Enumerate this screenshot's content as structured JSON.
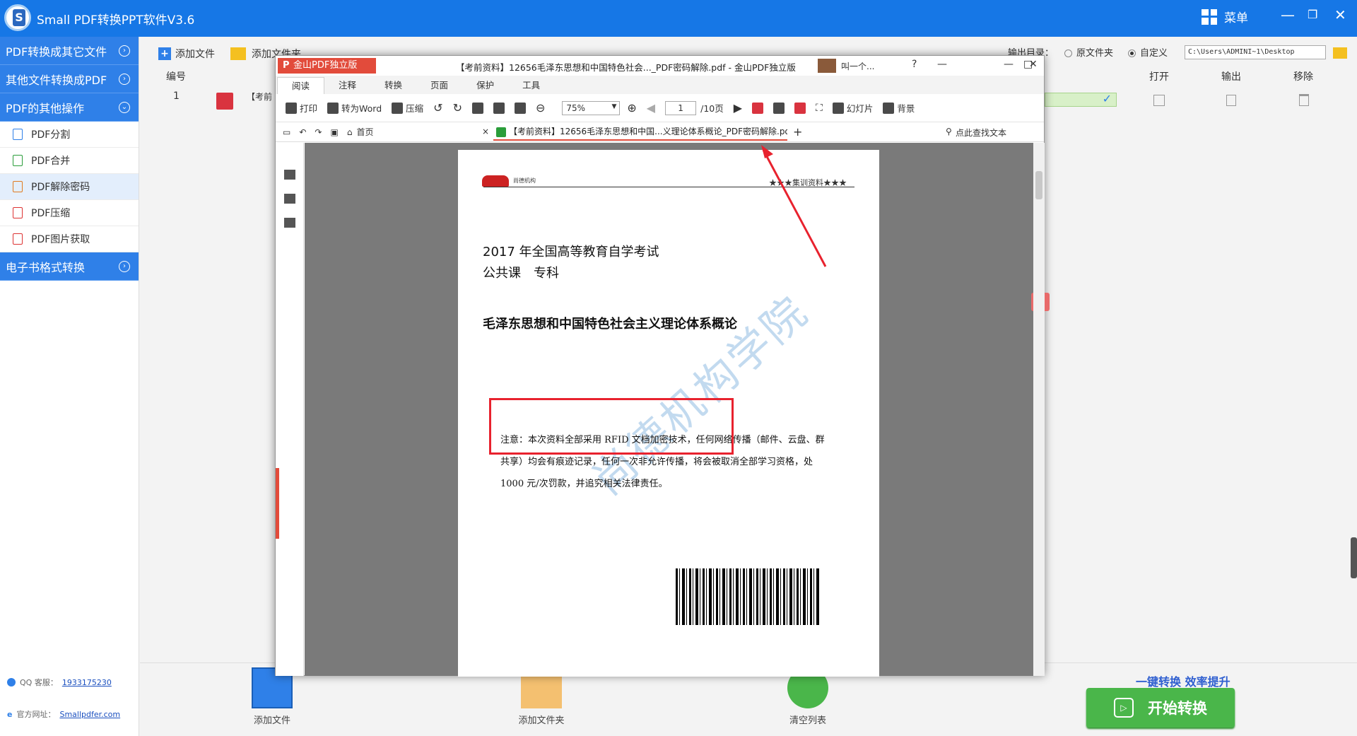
{
  "app": {
    "title": "Small PDF转换PPT软件V3.6",
    "menu_label": "菜单"
  },
  "sidebar": {
    "categories": [
      {
        "label": "PDF转换成其它文件"
      },
      {
        "label": "其他文件转换成PDF"
      },
      {
        "label": "PDF的其他操作"
      },
      {
        "label": "电子书格式转换"
      }
    ],
    "items": [
      {
        "label": "PDF分割"
      },
      {
        "label": "PDF合并"
      },
      {
        "label": "PDF解除密码"
      },
      {
        "label": "PDF压缩"
      },
      {
        "label": "PDF图片获取"
      }
    ],
    "qq_label": "QQ 客服：",
    "qq_value": "1933175230",
    "site_label": "官方网址：",
    "site_value": "Smallpdfer.com"
  },
  "toolbar": {
    "add_file": "添加文件",
    "add_folder": "添加文件夹"
  },
  "output": {
    "label": "输出目录：",
    "option_original": "原文件夹",
    "option_custom": "自定义",
    "path": "C:\\Users\\ADMINI~1\\Desktop"
  },
  "table": {
    "headers": {
      "index": "编号",
      "open": "打开",
      "output": "输出",
      "remove": "移除"
    },
    "rows": [
      {
        "index": "1",
        "name": "【考前"
      }
    ]
  },
  "bottom": {
    "add_file": "添加文件",
    "add_folder": "添加文件夹",
    "clear_list": "清空列表",
    "slogan": "一键转换  效率提升",
    "start": "开始转换"
  },
  "reader": {
    "brand": "金山PDF独立版",
    "doc_title": "【考前资料】12656毛泽东思想和中国特色社会..._PDF密码解除.pdf - 金山PDF独立版",
    "user": "叫一个...",
    "tabs": [
      "阅读",
      "注释",
      "转换",
      "页面",
      "保护",
      "工具"
    ],
    "tools": {
      "print": "打印",
      "to_word": "转为Word",
      "compress": "压缩",
      "zoom": "75%",
      "page": "1",
      "page_total": "/10页",
      "slideshow": "幻灯片",
      "background": "背景"
    },
    "home": "首页",
    "doc_tab": "【考前资料】12656毛泽东思想和中国...义理论体系概论_PDF密码解除.pdf",
    "search": "点此查找文本"
  },
  "document": {
    "header_right": "★★★集训资料★★★",
    "logo_text": "尚德机构",
    "line1": "2017 年全国高等教育自学考试",
    "line2": "公共课　专科",
    "title": "毛泽东思想和中国特色社会主义理论体系概论",
    "notice": "注意：本次资料全部采用 RFID 文档加密技术，任何网络传播（邮件、云盘、群共享）均会有痕迹记录，任何一次非允许传播，将会被取消全部学习资格，处 1000 元/次罚款，并追究相关法律责任。",
    "watermark": "尚德机构学院"
  },
  "colors": {
    "accent": "#1677e6",
    "sidebar_cat": "#2f80e8",
    "start": "#4ab64a",
    "reader_red": "#e24b3b",
    "annotation": "#e8222e"
  }
}
